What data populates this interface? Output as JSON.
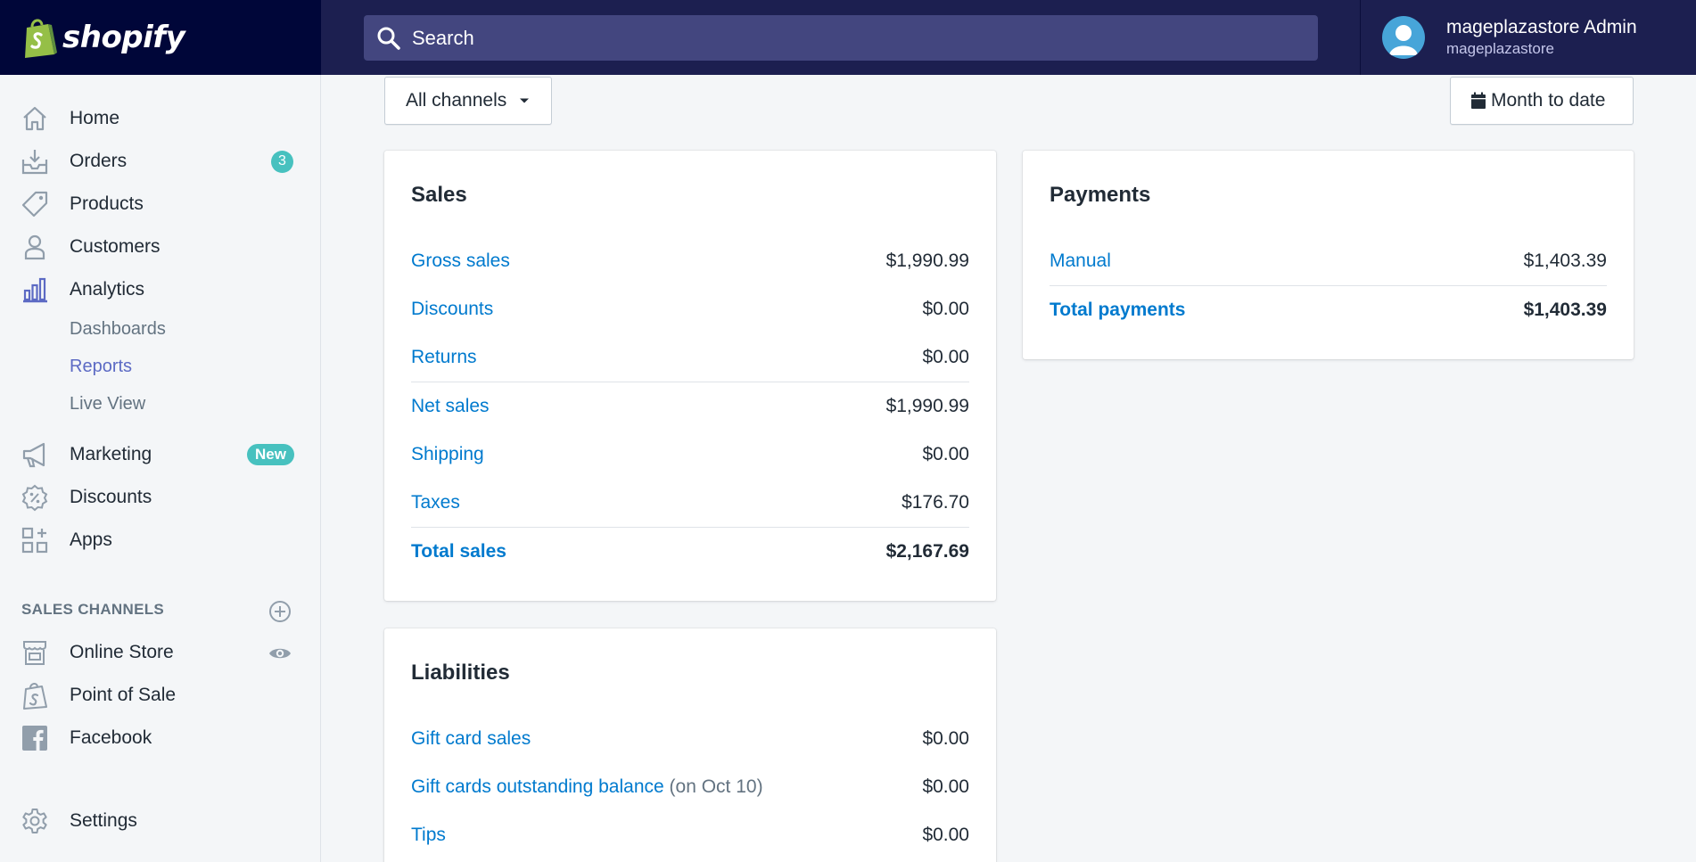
{
  "brand": {
    "name": "shopify"
  },
  "search": {
    "placeholder": "Search"
  },
  "user": {
    "name": "mageplazastore Admin",
    "store": "mageplazastore"
  },
  "sidebar": {
    "home": "Home",
    "orders": "Orders",
    "orders_badge": "3",
    "products": "Products",
    "customers": "Customers",
    "analytics": "Analytics",
    "analytics_sub": [
      "Dashboards",
      "Reports",
      "Live View"
    ],
    "marketing": "Marketing",
    "marketing_badge": "New",
    "discounts": "Discounts",
    "apps": "Apps",
    "sales_channels_heading": "SALES CHANNELS",
    "online_store": "Online Store",
    "point_of_sale": "Point of Sale",
    "facebook": "Facebook",
    "settings": "Settings"
  },
  "filters": {
    "channels": "All channels",
    "date_range": "Month to date"
  },
  "sales": {
    "title": "Sales",
    "rows": [
      {
        "label": "Gross sales",
        "value": "$1,990.99"
      },
      {
        "label": "Discounts",
        "value": "$0.00"
      },
      {
        "label": "Returns",
        "value": "$0.00"
      },
      {
        "label": "Net sales",
        "value": "$1,990.99"
      },
      {
        "label": "Shipping",
        "value": "$0.00"
      },
      {
        "label": "Taxes",
        "value": "$176.70"
      },
      {
        "label": "Total sales",
        "value": "$2,167.69"
      }
    ]
  },
  "payments": {
    "title": "Payments",
    "rows": [
      {
        "label": "Manual",
        "value": "$1,403.39"
      },
      {
        "label": "Total payments",
        "value": "$1,403.39"
      }
    ]
  },
  "liabilities": {
    "title": "Liabilities",
    "rows": [
      {
        "label": "Gift card sales",
        "value": "$0.00"
      },
      {
        "label": "Gift cards outstanding balance",
        "note": "(on Oct 10)",
        "value": "$0.00"
      },
      {
        "label": "Tips",
        "value": "$0.00"
      }
    ]
  },
  "colors": {
    "topbar": "#1c1f50",
    "logo_bg": "#000639",
    "link": "#007ace",
    "accent": "#5c6ac4",
    "badge": "#47c1bf"
  }
}
